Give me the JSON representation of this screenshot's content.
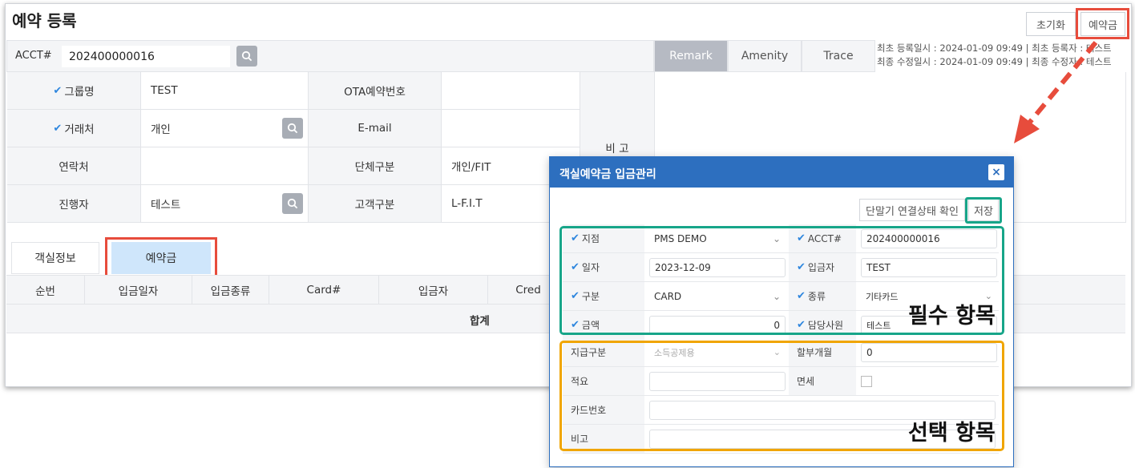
{
  "page": {
    "title": "예약 등록",
    "reset_button": "초기화",
    "deposit_button": "예약금"
  },
  "acct": {
    "label": "ACCT#",
    "value": "202400000016"
  },
  "side_tabs": [
    "Remark",
    "Amenity",
    "Trace"
  ],
  "meta": {
    "line1": "최초 등록일시 : 2024-01-09 09:49  |   최초 등록자 : 테스트",
    "line2": "최종 수정일시 : 2024-01-09 09:49  |   최종 수정자 : 테스트"
  },
  "form": {
    "group_name_label": "그룹명",
    "group_name_value": "TEST",
    "ota_label": "OTA예약번호",
    "ota_value": "",
    "client_label": "거래처",
    "client_value": "개인",
    "email_label": "E-mail",
    "email_value": "",
    "contact_label": "연락처",
    "contact_value": "",
    "group_type_label": "단체구분",
    "group_type_value": "개인/FIT",
    "manager_label": "진행자",
    "manager_value": "테스트",
    "customer_type_label": "고객구분",
    "customer_type_value": "L-F.I.T",
    "note_label": "비 고"
  },
  "bottom_tabs": [
    "객실정보",
    "예약금"
  ],
  "table": {
    "headers": [
      "순번",
      "입금일자",
      "입금종류",
      "Card#",
      "입금자",
      "Cred"
    ],
    "sum_label": "합계"
  },
  "dialog": {
    "title": "객실예약금 입금관리",
    "close_icon": "×",
    "check_terminal_button": "단말기 연결상태 확인",
    "save_button": "저장",
    "branch_label": "지점",
    "branch_value": "PMS DEMO",
    "acct_label": "ACCT#",
    "acct_value": "202400000016",
    "date_label": "일자",
    "date_value": "2023-12-09",
    "depositor_label": "입금자",
    "depositor_value": "TEST",
    "category_label": "구분",
    "category_value": "CARD",
    "kind_label": "종류",
    "kind_value": "기타카드",
    "amount_label": "금액",
    "amount_value": "0",
    "staff_label": "담당사원",
    "staff_value": "테스트",
    "pay_type_label": "지급구분",
    "pay_type_value": "소득공제용",
    "installment_label": "할부개월",
    "installment_value": "0",
    "summary_label": "적요",
    "summary_value": "",
    "tax_free_label": "면세",
    "card_no_label": "카드번호",
    "card_no_value": "",
    "note_label": "비고",
    "note_value": ""
  },
  "annotations": {
    "required": "필수 항목",
    "optional": "선택 항목"
  },
  "colors": {
    "accent_blue": "#2d6fbf",
    "highlight_red": "#e74c3c",
    "required_teal": "#17a589",
    "optional_orange": "#f0a500",
    "active_tab": "#b6bac3"
  }
}
